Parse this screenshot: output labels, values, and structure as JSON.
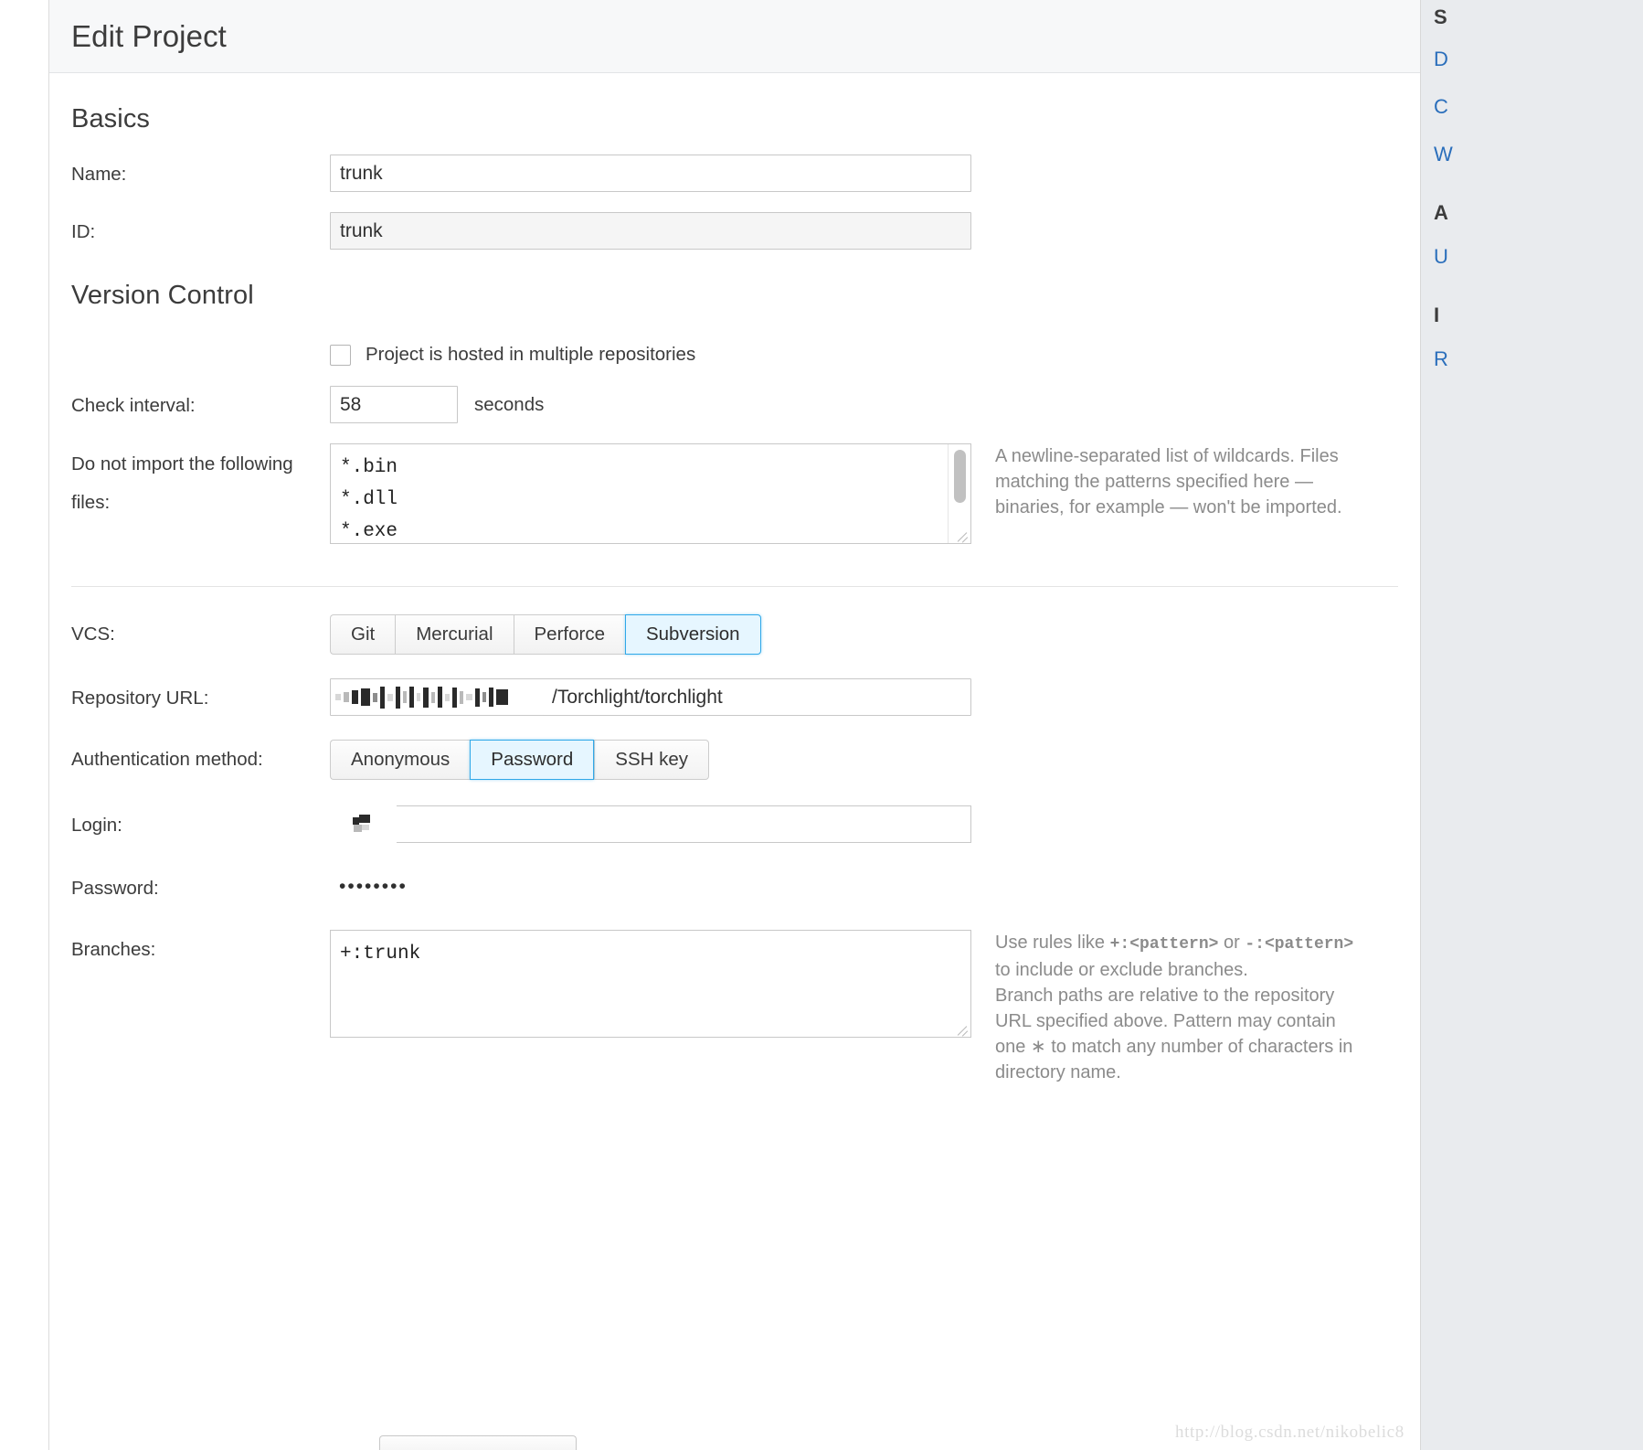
{
  "header": {
    "title": "Edit Project"
  },
  "sections": {
    "basics": {
      "title": "Basics",
      "name_label": "Name:",
      "name_value": "trunk",
      "id_label": "ID:",
      "id_value": "trunk"
    },
    "version_control": {
      "title": "Version Control",
      "multi_repo_checkbox_label": "Project is hosted in multiple repositories",
      "multi_repo_checked": false,
      "check_interval_label": "Check interval:",
      "check_interval_value": "58",
      "check_interval_unit": "seconds",
      "ignore_label": "Do not import the following files:",
      "ignore_value": "*.bin\n*.dll\n*.exe",
      "ignore_help": "A newline-separated list of wildcards. Files matching the patterns specified here — binaries, for example — won't be imported.",
      "vcs_label": "VCS:",
      "vcs_options": [
        "Git",
        "Mercurial",
        "Perforce",
        "Subversion"
      ],
      "vcs_selected": "Subversion",
      "repo_url_label": "Repository URL:",
      "repo_url_visible_text": "/Torchlight/torchlight",
      "repo_url_masked": true,
      "auth_label": "Authentication method:",
      "auth_options": [
        "Anonymous",
        "Password",
        "SSH key"
      ],
      "auth_selected": "Password",
      "login_label": "Login:",
      "login_value_masked": true,
      "password_label": "Password:",
      "password_value": "••••••••",
      "branches_label": "Branches:",
      "branches_value": "+:trunk",
      "branches_help_part1": "Use rules like ",
      "branches_help_code1": "+:<pattern>",
      "branches_help_part2": " or ",
      "branches_help_code2": "-:<pattern>",
      "branches_help_part3": " to include or exclude branches.",
      "branches_help_line2": "Branch paths are relative to the repository URL specified above. Pattern may contain one ∗ to match any number of characters in directory name."
    }
  },
  "right_rail": {
    "heading_1": "S",
    "links_1": [
      "D",
      "C",
      "W"
    ],
    "heading_2": "A",
    "links_2": [
      "U"
    ],
    "heading_3": "I",
    "links_3": [
      "R"
    ]
  },
  "watermark": "http://blog.csdn.net/nikobelic8",
  "colors": {
    "accent_blue": "#2fa8e8",
    "selected_bg": "#e6f6ff",
    "link_blue": "#2a6ebb",
    "header_bg": "#f7f8f9",
    "rail_bg": "#e9ebee",
    "help_text": "#8b8b8b"
  }
}
